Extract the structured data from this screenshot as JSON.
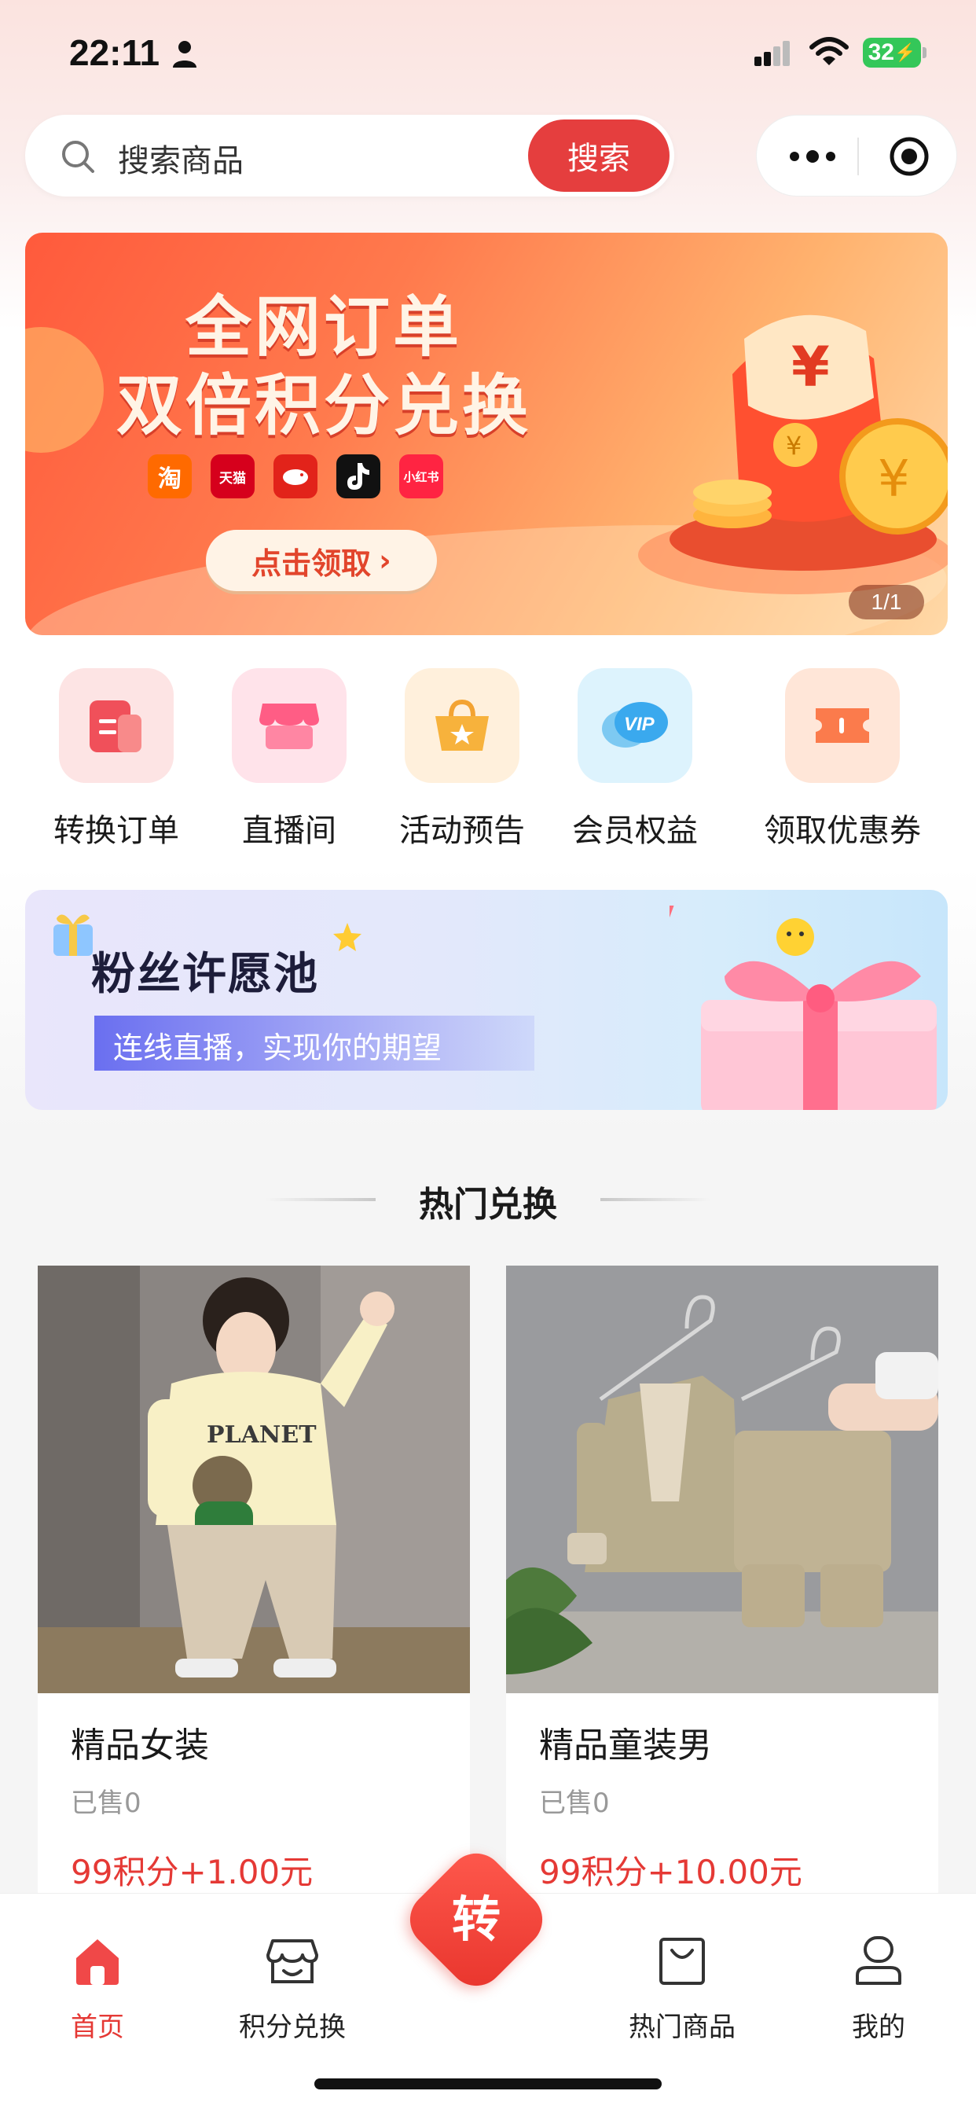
{
  "status_bar": {
    "time": "22:11",
    "battery": "32"
  },
  "search": {
    "placeholder": "搜索商品",
    "button_label": "搜索"
  },
  "banner": {
    "title_line1": "全网订单",
    "title_line2": "双倍积分兑换",
    "platforms": [
      "淘",
      "天猫",
      "",
      "",
      "小红书"
    ],
    "cta_label": "点击领取",
    "pager": "1/1"
  },
  "quick_menu": [
    {
      "label": "转换订单",
      "icon": "order-icon"
    },
    {
      "label": "直播间",
      "icon": "shop-icon"
    },
    {
      "label": "活动预告",
      "icon": "basket-star-icon"
    },
    {
      "label": "会员权益",
      "icon": "vip-chat-icon"
    },
    {
      "label": "领取优惠券",
      "icon": "coupon-icon"
    }
  ],
  "wish_banner": {
    "title": "粉丝许愿池",
    "subtitle": "连线直播，实现你的期望"
  },
  "section": {
    "title": "热门兑换"
  },
  "products": [
    {
      "name": "精品女装",
      "sold": "已售0",
      "price": "99积分+1.00元"
    },
    {
      "name": "精品童装男",
      "sold": "已售0",
      "price": "99积分+10.00元"
    }
  ],
  "tab_bar": {
    "items": [
      {
        "label": "首页",
        "icon": "home-icon",
        "active": true
      },
      {
        "label": "积分兑换",
        "icon": "store-icon",
        "active": false
      },
      {
        "label": "热门商品",
        "icon": "bag-icon",
        "active": false
      },
      {
        "label": "我的",
        "icon": "user-icon",
        "active": false
      }
    ],
    "center_label": "转"
  },
  "colors": {
    "accent": "#e53935",
    "search_button": "#e53e3e",
    "battery": "#34c759"
  }
}
